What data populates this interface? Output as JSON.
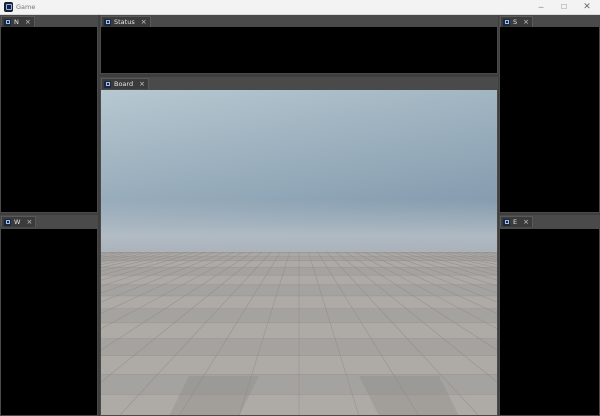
{
  "window": {
    "title": "Game",
    "controls": {
      "minimize": "─",
      "maximize": "☐",
      "close": "✕"
    }
  },
  "panels": {
    "north": {
      "tab_label": "N",
      "close": "×"
    },
    "west": {
      "tab_label": "W",
      "close": "×"
    },
    "status": {
      "tab_label": "Status",
      "close": "×"
    },
    "board": {
      "tab_label": "Board",
      "close": "×"
    },
    "south": {
      "tab_label": "S",
      "close": "×"
    },
    "east": {
      "tab_label": "E",
      "close": "×"
    }
  },
  "colors": {
    "frame": "#3e3e3e",
    "panel_bg": "#000000",
    "sky_top": "#b7c8d1",
    "sky_bottom": "#7e95a8",
    "floor": "#a9a6a3"
  },
  "icons": {
    "app": "app-icon",
    "tab": "panel-icon"
  }
}
